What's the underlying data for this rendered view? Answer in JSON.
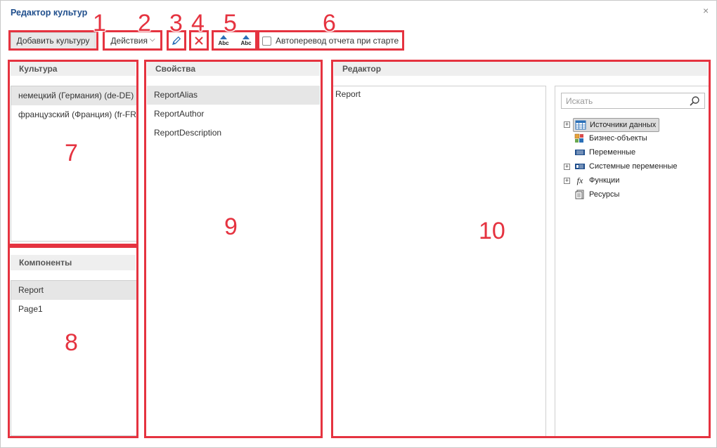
{
  "window": {
    "title": "Редактор культур",
    "close_glyph": "×"
  },
  "toolbar": {
    "add_culture": "Добавить культуру",
    "actions": "Действия",
    "actions_chevron": "⌵",
    "auto_translate": "Автоперевод отчета при старте",
    "abc_label": "Abc"
  },
  "markers": [
    "1",
    "2",
    "3",
    "4",
    "5",
    "6",
    "7",
    "8",
    "9",
    "10"
  ],
  "cultures": {
    "header": "Культура",
    "items": [
      "немецкий (Германия) (de-DE)",
      "французский (Франция) (fr-FR)"
    ]
  },
  "components": {
    "header": "Компоненты",
    "items": [
      "Report",
      "Page1"
    ]
  },
  "properties": {
    "header": "Свойства",
    "items": [
      "ReportAlias",
      "ReportAuthor",
      "ReportDescription"
    ]
  },
  "editor": {
    "header": "Редактор",
    "text": "Report",
    "search_placeholder": "Искать",
    "tree": [
      {
        "label": "Источники данных",
        "expand": "+",
        "icon": "data-sources-icon"
      },
      {
        "label": "Бизнес-объекты",
        "expand": "",
        "icon": "business-objects-icon"
      },
      {
        "label": "Переменные",
        "expand": "",
        "icon": "variables-icon"
      },
      {
        "label": "Системные переменные",
        "expand": "+",
        "icon": "system-variables-icon"
      },
      {
        "label": "Функции",
        "expand": "+",
        "icon": "functions-icon"
      },
      {
        "label": "Ресурсы",
        "expand": "",
        "icon": "resources-icon"
      }
    ],
    "fx_glyph": "fx"
  },
  "colors": {
    "accent_red": "#e53340",
    "title_blue": "#1f4e8c",
    "selection": "#e6e6e6"
  }
}
